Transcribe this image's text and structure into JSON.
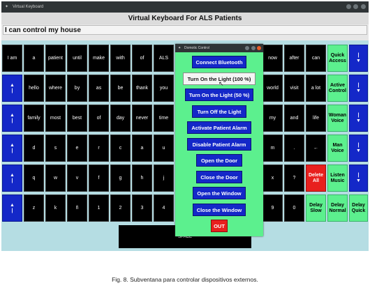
{
  "window": {
    "title": "Virtual Keyboard"
  },
  "heading": "Virtual Keyboard For ALS Patients",
  "text_field": "I can control my house",
  "rows": [
    [
      "I am",
      "a",
      "patient",
      "until",
      "make",
      "with",
      "of",
      "ALS"
    ],
    [
      "hello",
      "where",
      "by",
      "as",
      "be",
      "thank",
      "you"
    ],
    [
      "family",
      "most",
      "best",
      "of",
      "day",
      "never",
      "time"
    ],
    [
      "d",
      "s",
      "e",
      "r",
      "c",
      "a",
      "u"
    ],
    [
      "q",
      "w",
      "v",
      "f",
      "g",
      "h",
      "j"
    ],
    [
      "z",
      "k",
      "ñ",
      "1",
      "2",
      "3",
      "4"
    ]
  ],
  "right_cols": [
    [
      "now",
      "after",
      "can"
    ],
    [
      "world",
      "visit",
      "a lot"
    ],
    [
      "my",
      "and",
      "life"
    ],
    [
      "m",
      ".",
      "←"
    ],
    [
      "x",
      "?"
    ],
    [
      "9",
      "0"
    ]
  ],
  "side_keys": {
    "quick_access": "Quick Access",
    "active_control": "Active Control",
    "woman_voice": "Woman Voice",
    "man_voice": "Man Voice",
    "delete_all": "Delete All",
    "listen_music": "Listen Music",
    "delay_slow": "Delay Slow",
    "delay_normal": "Delay Normal",
    "delay_quick": "Delay Quick"
  },
  "arrow_up": "▲",
  "arrow_down": "▼",
  "arrow_bar": "|",
  "space_label": "SPACE",
  "dialog": {
    "title": "Domotic Control",
    "buttons": [
      "Connect Bluetooth",
      "Turn On the Light (100 %)",
      "Turn On the Light (50 %)",
      "Turn Off the Light",
      "Activate Patient Alarm",
      "Disable Patient Alarm",
      "Open the Door",
      "Close the Door",
      "Open the Window",
      "Close the Window"
    ],
    "out_label": "OUT"
  },
  "caption": "Fig. 8. Subventana para controlar dispositivos externos.",
  "colors": {
    "key_bg": "#000000",
    "green": "#5cf08e",
    "blue": "#1428c8",
    "red": "#e8201e",
    "area_bg": "#b5dde3"
  }
}
